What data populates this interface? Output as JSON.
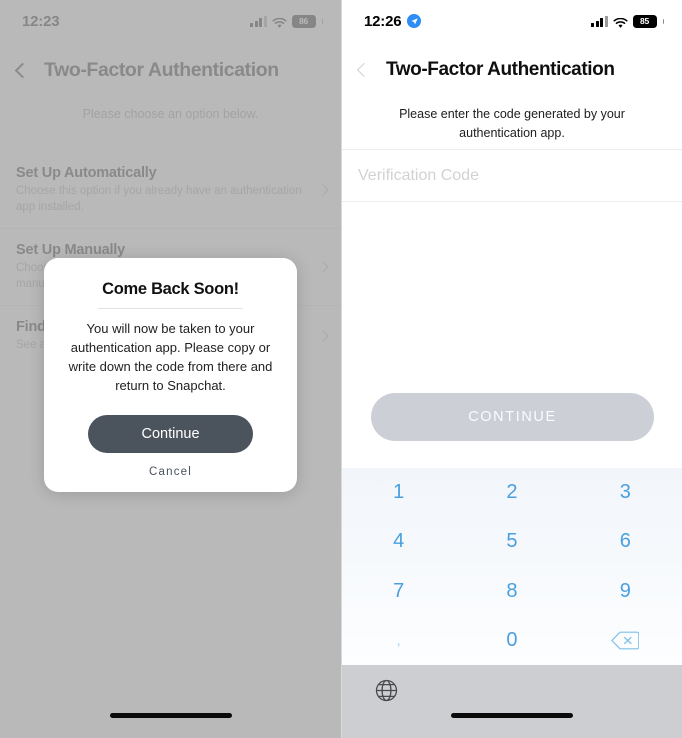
{
  "left_screen": {
    "status_bar": {
      "time": "12:23",
      "battery": "86",
      "signal_icon": "cellular-bars-icon",
      "wifi_icon": "wifi-icon",
      "battery_icon": "battery-icon"
    },
    "nav": {
      "back_icon": "chevron-left-icon",
      "title": "Two-Factor Authentication"
    },
    "subtitle": "Please choose an option below.",
    "options": [
      {
        "title": "Set Up Automatically",
        "subtitle": "Choose this option if you already have an authentication app installed.",
        "chevron_icon": "chevron-right-icon"
      },
      {
        "title": "Set Up Manually",
        "subtitle": "Choose this option to set up an authentication app manually (for ex",
        "chevron_icon": "chevron-right-icon"
      },
      {
        "title": "Find",
        "subtitle": "See a",
        "chevron_icon": "chevron-right-icon"
      }
    ],
    "modal": {
      "title": "Come Back Soon!",
      "body": "You will now be taken to your authentication app. Please copy or write down the code from there and return to Snapchat.",
      "continue_label": "Continue",
      "cancel_label": "Cancel",
      "continue_color": "#4b535c"
    }
  },
  "right_screen": {
    "status_bar": {
      "time": "12:26",
      "battery": "85",
      "location_icon": "location-arrow-icon",
      "signal_icon": "cellular-bars-icon",
      "wifi_icon": "wifi-icon",
      "battery_icon": "battery-icon"
    },
    "nav": {
      "back_icon": "chevron-left-double-icon",
      "title": "Two-Factor Authentication"
    },
    "instruction": "Please enter the code generated by your authentication app.",
    "input": {
      "value": "",
      "placeholder": "Verification Code"
    },
    "continue_label": "CONTINUE",
    "continue_disabled_color": "#ccd0d6",
    "keypad": {
      "keys": [
        "1",
        "2",
        "3",
        "4",
        "5",
        "6",
        "7",
        "8",
        "9",
        ",",
        "0",
        "backspace"
      ],
      "backspace_icon": "backspace-delete-icon",
      "key_color": "#4a9fe0",
      "background_color": "#f4f7fb"
    },
    "bottom_bar": {
      "globe_icon": "globe-language-icon"
    }
  }
}
